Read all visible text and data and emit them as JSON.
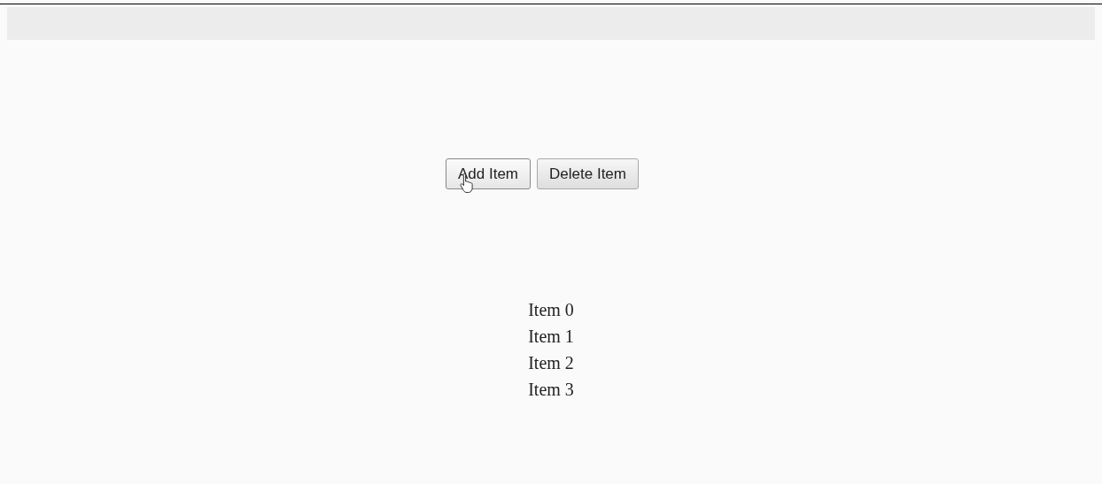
{
  "buttons": [
    {
      "label": "Add Item",
      "hovered": true
    },
    {
      "label": "Delete Item",
      "hovered": false
    }
  ],
  "items": [
    "Item 0",
    "Item 1",
    "Item 2",
    "Item 3"
  ]
}
